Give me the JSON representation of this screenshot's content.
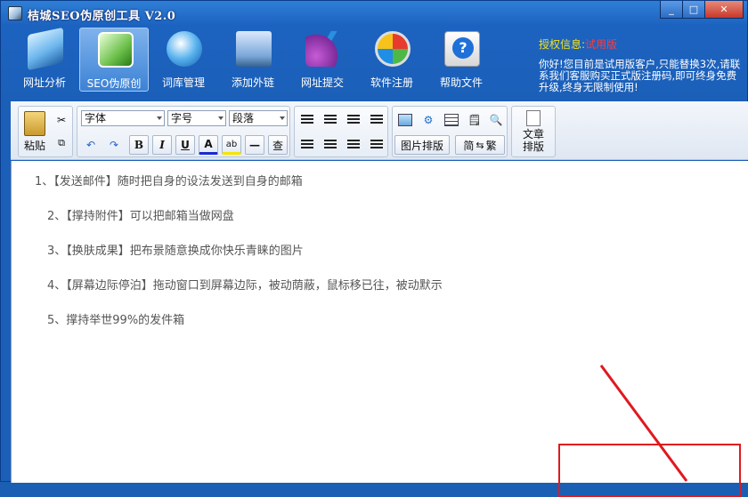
{
  "window": {
    "title": "桔城SEO伪原创工具 V2.0",
    "controls": [
      "_",
      "□",
      "✕"
    ]
  },
  "nav": {
    "items": [
      {
        "label": "网址分析",
        "icon": "book-icon"
      },
      {
        "label": "SEO伪原创",
        "icon": "pages-icon",
        "active": true
      },
      {
        "label": "词库管理",
        "icon": "globe-icon"
      },
      {
        "label": "添加外链",
        "icon": "laptop-icon"
      },
      {
        "label": "网址提交",
        "icon": "pen-icon"
      },
      {
        "label": "软件注册",
        "icon": "shield-icon"
      },
      {
        "label": "帮助文件",
        "icon": "help-icon"
      }
    ]
  },
  "license": {
    "label": "授权信息:",
    "value": "试用版",
    "message": "你好!您目前是试用版客户,只能替换3次,请联系我们客服购买正式版注册码,即可终身免费升级,终身无限制使用!"
  },
  "toolbar": {
    "paste": "粘贴",
    "font": "字体",
    "size": "字号",
    "paragraph": "段落",
    "bold": "B",
    "italic": "I",
    "underline": "U",
    "font_color": "A",
    "highlight": "ab",
    "rule": "—",
    "find": "查",
    "image_layout": "图片排版",
    "convert_jian": "简",
    "convert_fan": "繁",
    "article_layout_1": "文章",
    "article_layout_2": "排版"
  },
  "editor": {
    "lines": [
      "1、【发送邮件】随时把自身的设法发送到自身的邮箱",
      "2、【撑持附件】可以把邮箱当做网盘",
      "3、【换肤成果】把布景随意换成你快乐青睐的图片",
      "4、【屏幕边际停泊】拖动窗口到屏幕边际，被动荫蔽，鼠标移已往，被动默示",
      "5、撑持举世99%的发件箱"
    ]
  },
  "colors": {
    "titlebar": "#2f7fd6",
    "license_label": "#f6e11a",
    "license_value": "#ff3b3b",
    "annotation": "#e0191f"
  }
}
